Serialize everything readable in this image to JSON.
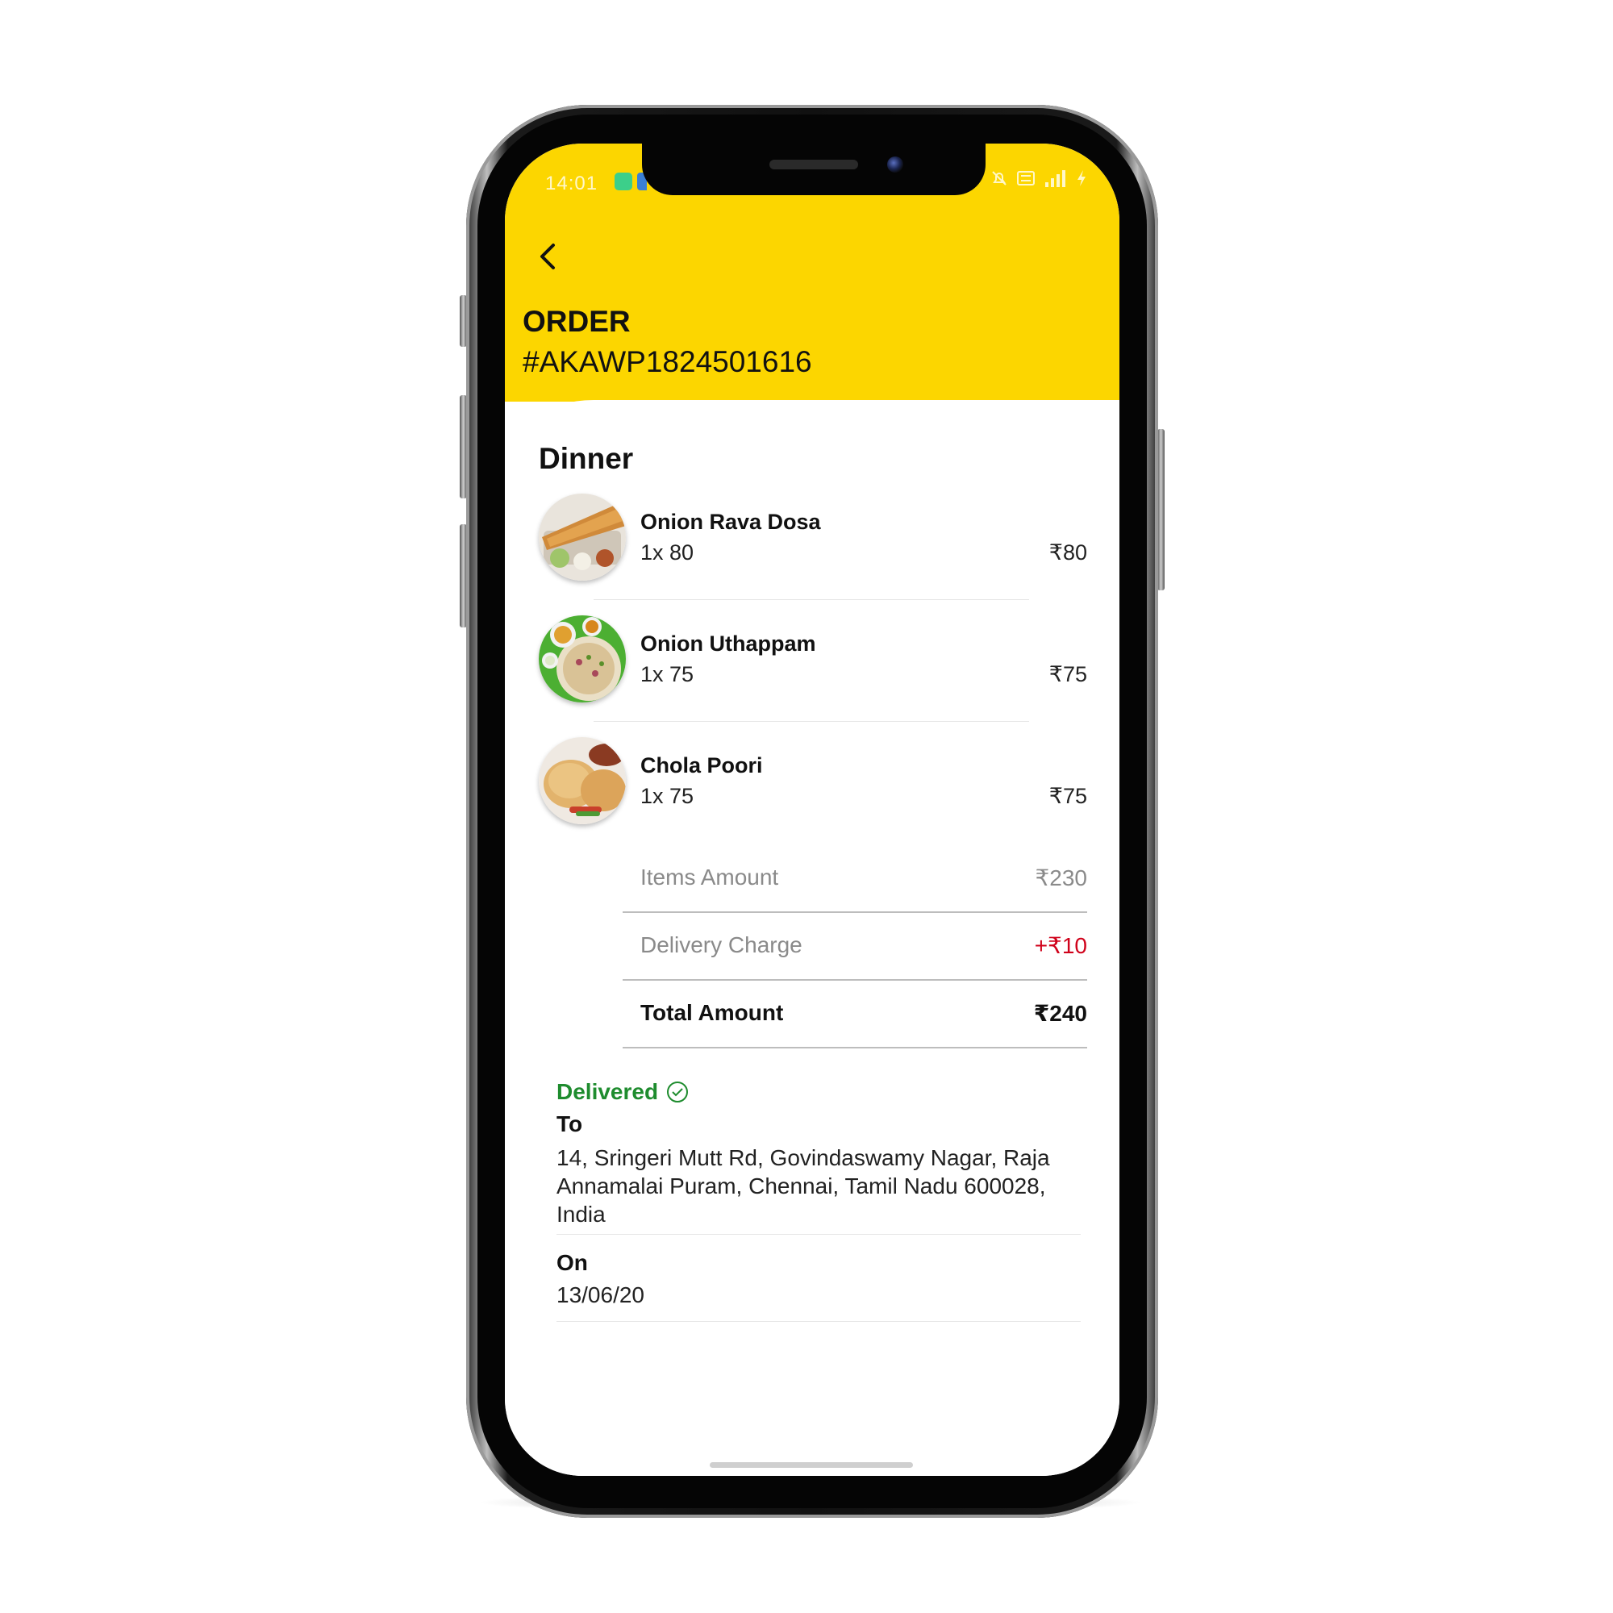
{
  "status_bar": {
    "time": "14:01"
  },
  "header": {
    "title": "ORDER",
    "order_number": "#AKAWP1824501616"
  },
  "section": {
    "title": "Dinner"
  },
  "items": [
    {
      "name": "Onion Rava Dosa",
      "qty": "1x 80",
      "price": "₹80"
    },
    {
      "name": "Onion Uthappam",
      "qty": "1x 75",
      "price": "₹75"
    },
    {
      "name": "Chola Poori",
      "qty": "1x 75",
      "price": "₹75"
    }
  ],
  "summary": {
    "items_amount_label": "Items Amount",
    "items_amount": "₹230",
    "delivery_label": "Delivery Charge",
    "delivery": "+₹10",
    "total_label": "Total Amount",
    "total": "₹240"
  },
  "delivery": {
    "status": "Delivered",
    "to_label": "To",
    "address": "14, Sringeri Mutt Rd, Govindaswamy Nagar, Raja Annamalai Puram, Chennai, Tamil Nadu 600028, India",
    "on_label": "On",
    "date": "13/06/20"
  },
  "colors": {
    "header": "#fcd600",
    "delivered": "#1e8c2e",
    "charge": "#d0021b"
  },
  "icons": {
    "back": "chevron-left-icon",
    "delivered": "check-circle-icon"
  }
}
